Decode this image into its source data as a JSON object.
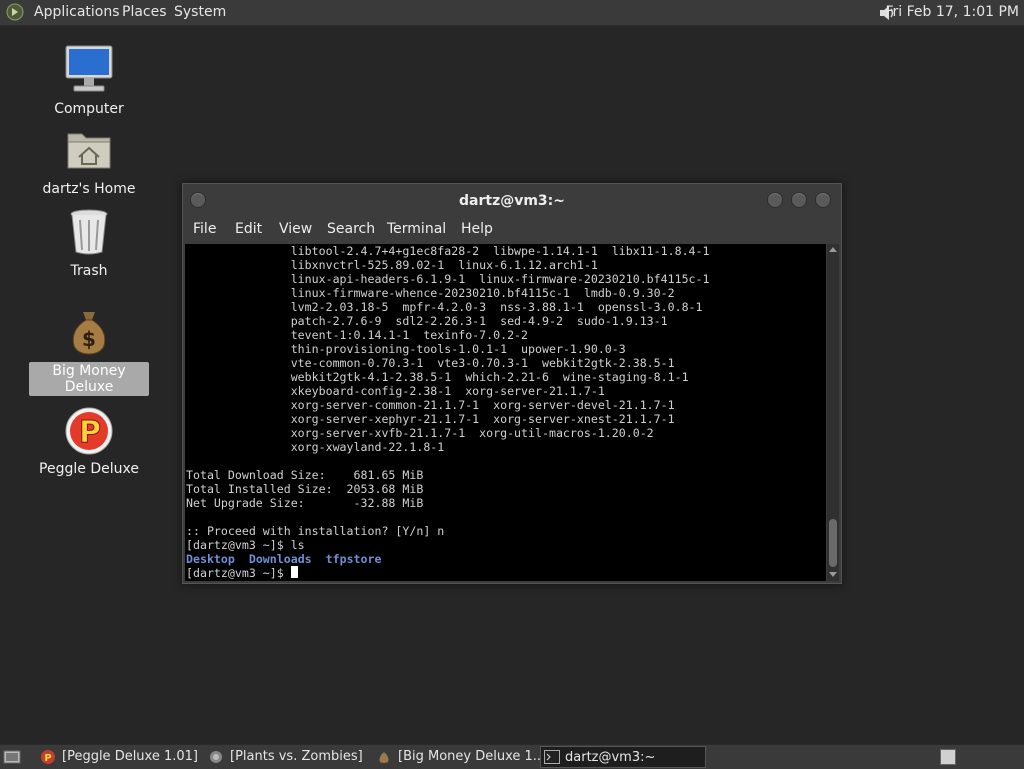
{
  "topbar": {
    "menus": [
      "Applications",
      "Places",
      "System"
    ],
    "clock": "Fri Feb 17,  1:01 PM",
    "icons": {
      "logo": "distro-logo-icon",
      "volume": "volume-icon"
    }
  },
  "desktop": {
    "icons": [
      {
        "label": "Computer",
        "icon": "computer-icon"
      },
      {
        "label": "dartz's Home",
        "icon": "home-folder-icon"
      },
      {
        "label": "Trash",
        "icon": "trash-icon"
      },
      {
        "label": "Big Money Deluxe",
        "icon": "money-bag-icon",
        "selected": true
      },
      {
        "label": "Peggle Deluxe",
        "icon": "peggle-icon"
      }
    ]
  },
  "terminal_window": {
    "title": "dartz@vm3:~",
    "menu": [
      "File",
      "Edit",
      "View",
      "Search",
      "Terminal",
      "Help"
    ],
    "lines": [
      "               libtool-2.4.7+4+g1ec8fa28-2  libwpe-1.14.1-1  libx11-1.8.4-1",
      "               libxnvctrl-525.89.02-1  linux-6.1.12.arch1-1",
      "               linux-api-headers-6.1.9-1  linux-firmware-20230210.bf4115c-1",
      "               linux-firmware-whence-20230210.bf4115c-1  lmdb-0.9.30-2",
      "               lvm2-2.03.18-5  mpfr-4.2.0-3  nss-3.88.1-1  openssl-3.0.8-1",
      "               patch-2.7.6-9  sdl2-2.26.3-1  sed-4.9-2  sudo-1.9.13-1",
      "               tevent-1:0.14.1-1  texinfo-7.0.2-2",
      "               thin-provisioning-tools-1.0.1-1  upower-1.90.0-3",
      "               vte-common-0.70.3-1  vte3-0.70.3-1  webkit2gtk-2.38.5-1",
      "               webkit2gtk-4.1-2.38.5-1  which-2.21-6  wine-staging-8.1-1",
      "               xkeyboard-config-2.38-1  xorg-server-21.1.7-1",
      "               xorg-server-common-21.1.7-1  xorg-server-devel-21.1.7-1",
      "               xorg-server-xephyr-21.1.7-1  xorg-server-xnest-21.1.7-1",
      "               xorg-server-xvfb-21.1.7-1  xorg-util-macros-1.20.0-2",
      "               xorg-xwayland-22.1.8-1",
      "",
      "Total Download Size:    681.65 MiB",
      "Total Installed Size:  2053.68 MiB",
      "Net Upgrade Size:       -32.88 MiB",
      "",
      ":: Proceed with installation? [Y/n] n",
      "[dartz@vm3 ~]$ ls"
    ],
    "ls_output": [
      "Desktop",
      "Downloads",
      "tfpstore"
    ],
    "prompt": "[dartz@vm3 ~]$ "
  },
  "taskbar": {
    "tasks": [
      {
        "label": "[Peggle Deluxe 1.01]",
        "icon": "peggle-icon"
      },
      {
        "label": "[Plants vs. Zombies]",
        "icon": "plants-icon"
      },
      {
        "label": "[Big Money Deluxe 1...",
        "icon": "money-bag-icon"
      },
      {
        "label": "dartz@vm3:~",
        "icon": "terminal-icon",
        "active": true
      }
    ]
  }
}
